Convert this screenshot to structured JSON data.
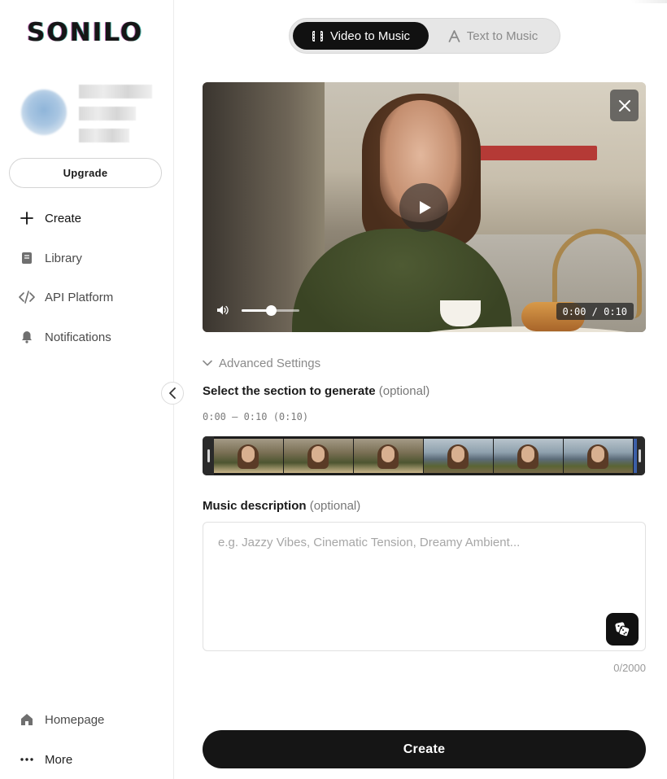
{
  "brand": {
    "logo_text": "SONILO"
  },
  "sidebar": {
    "upgrade_label": "Upgrade",
    "nav": [
      {
        "label": "Create",
        "icon": "plus-icon",
        "active": true
      },
      {
        "label": "Library",
        "icon": "book-icon"
      },
      {
        "label": "API Platform",
        "icon": "code-icon"
      },
      {
        "label": "Notifications",
        "icon": "bell-icon"
      }
    ],
    "bottom_nav": [
      {
        "label": "Homepage",
        "icon": "home-icon"
      },
      {
        "label": "More",
        "icon": "more-dots-icon"
      }
    ]
  },
  "mode_toggle": {
    "video_to_music": "Video to Music",
    "text_to_music": "Text to Music",
    "active": "video_to_music"
  },
  "video": {
    "time_display": "0:00 / 0:10",
    "volume_level": 0.5
  },
  "advanced_settings_label": "Advanced Settings",
  "section_select": {
    "title": "Select the section to generate",
    "optional": "(optional)",
    "range_text": "0:00 — 0:10 (0:10)"
  },
  "music_description": {
    "title": "Music description",
    "optional": "(optional)",
    "placeholder": "e.g. Jazzy Vibes, Cinematic Tension, Dreamy Ambient...",
    "value": "",
    "counter": "0/2000"
  },
  "create_label": "Create",
  "colors": {
    "primary": "#111111",
    "muted_text": "#8a8a8a",
    "border": "#e1e1e1"
  }
}
